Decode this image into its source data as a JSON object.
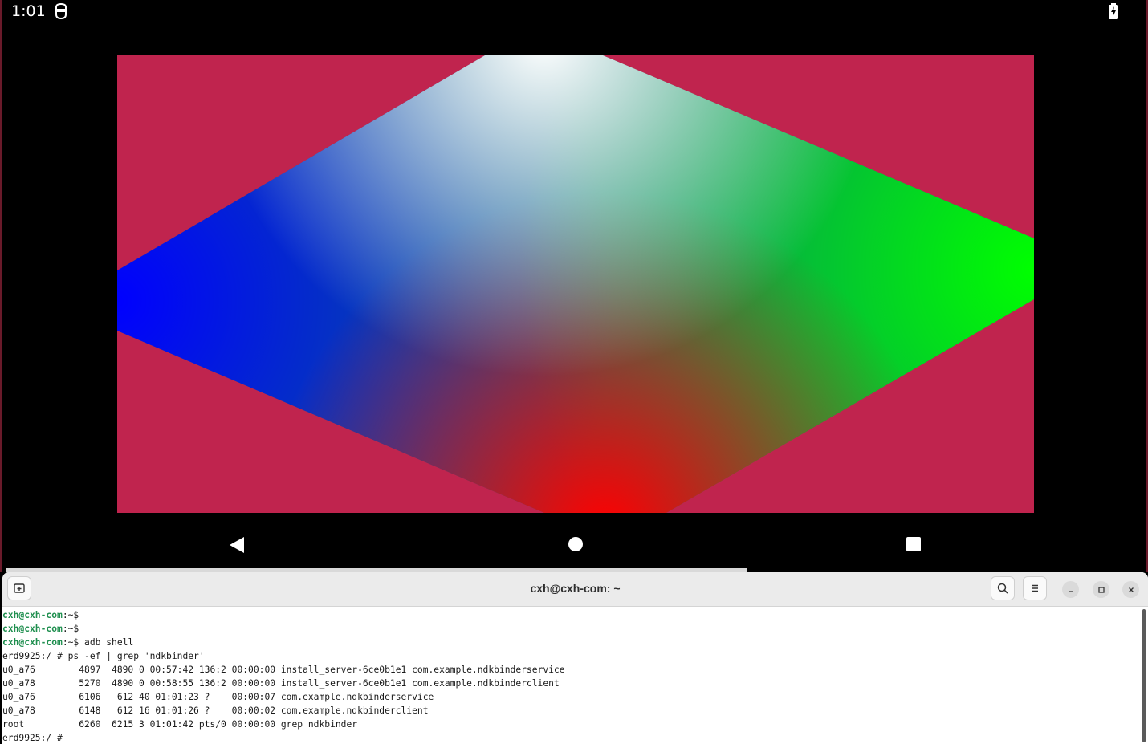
{
  "android": {
    "status_time": "1:01",
    "status_app_icon": "android-debug-icon",
    "battery_icon": "battery-charging-icon",
    "background_color": "#c0244e",
    "gradient_colors": {
      "top": "#ffffff",
      "left": "#0000ff",
      "right": "#00ff00",
      "bottom": "#ff0000"
    },
    "nav": {
      "back_icon": "back-triangle-icon",
      "home_icon": "home-circle-icon",
      "recents_icon": "recents-square-icon"
    }
  },
  "terminal": {
    "title": "cxh@cxh-com: ~",
    "new_tab_icon": "new-tab-icon",
    "search_icon": "search-icon",
    "menu_icon": "hamburger-menu-icon",
    "minimize_icon": "minimize-icon",
    "maximize_icon": "maximize-icon",
    "close_icon": "close-icon",
    "prompt_user": "cxh@cxh-com",
    "lines": [
      {
        "prompt": "cxh@cxh-com",
        "path": ":~$",
        "text": ""
      },
      {
        "prompt": "cxh@cxh-com",
        "path": ":~$",
        "text": ""
      },
      {
        "prompt": "cxh@cxh-com",
        "path": ":~$",
        "text": " adb shell"
      },
      {
        "prompt": "",
        "path": "",
        "text": "erd9925:/ # ps -ef | grep 'ndkbinder'"
      },
      {
        "prompt": "",
        "path": "",
        "text": "u0_a76        4897  4890 0 00:57:42 136:2 00:00:00 install_server-6ce0b1e1 com.example.ndkbinderservice"
      },
      {
        "prompt": "",
        "path": "",
        "text": "u0_a78        5270  4890 0 00:58:55 136:2 00:00:00 install_server-6ce0b1e1 com.example.ndkbinderclient"
      },
      {
        "prompt": "",
        "path": "",
        "text": "u0_a76        6106   612 40 01:01:23 ?    00:00:07 com.example.ndkbinderservice"
      },
      {
        "prompt": "",
        "path": "",
        "text": "u0_a78        6148   612 16 01:01:26 ?    00:00:02 com.example.ndkbinderclient"
      },
      {
        "prompt": "",
        "path": "",
        "text": "root          6260  6215 3 01:01:42 pts/0 00:00:00 grep ndkbinder"
      },
      {
        "prompt": "",
        "path": "",
        "text": "erd9925:/ #"
      }
    ],
    "prompt_color": "#1f8f4f"
  }
}
